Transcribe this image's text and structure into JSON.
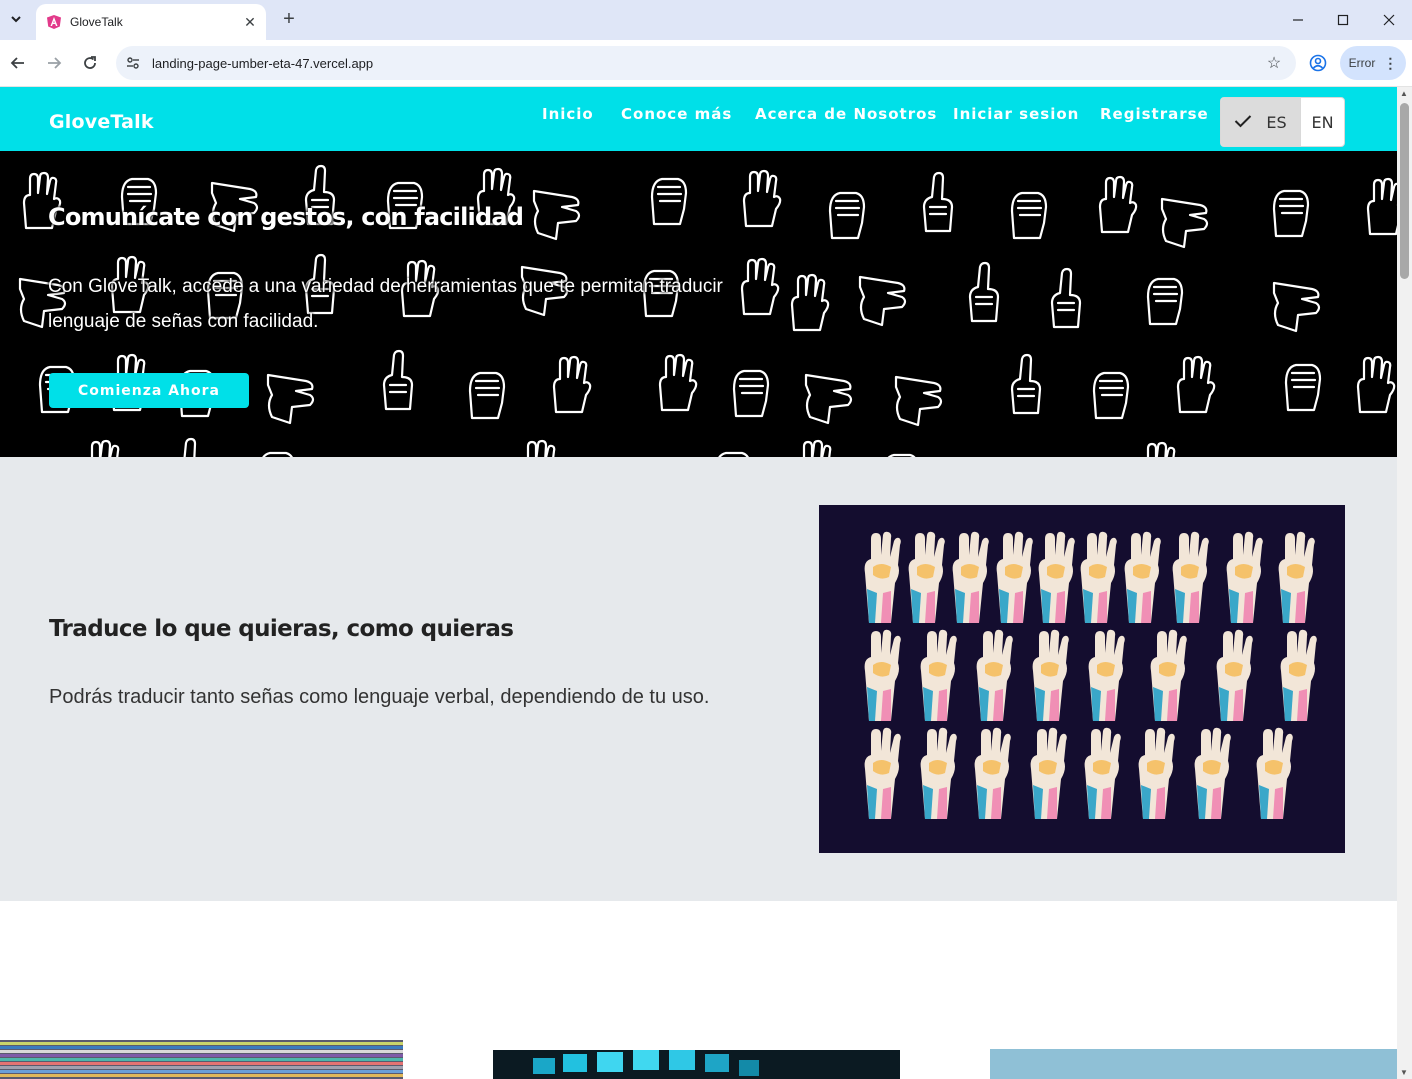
{
  "browser": {
    "tab_title": "GloveTalk",
    "url": "landing-page-umber-eta-47.vercel.app",
    "profile_status": "Error"
  },
  "navbar": {
    "brand": "GloveTalk",
    "links": [
      "Inicio",
      "Conoce más",
      "Acerca de Nosotros",
      "Iniciar sesion",
      "Registrarse"
    ],
    "lang_es": "ES",
    "lang_en": "EN",
    "selected_lang": "ES"
  },
  "hero": {
    "title": "Comunícate con gestos, con facilidad",
    "text": "Con GloveTalk, accede a una variedad de herramientas que te permitan traducir lenguaje de señas con facilidad.",
    "cta": "Comienza Ahora"
  },
  "feature": {
    "title": "Traduce lo que quieras, como quieras",
    "text": "Podrás traducir tanto señas como lenguaje verbal, dependiendo de tu uso."
  },
  "colors": {
    "accent": "#00e0e8",
    "hero_bg": "#000000",
    "feature_bg": "#e6e9ec",
    "image_bg": "#140d2f"
  },
  "icons": [
    "search-tabs-icon",
    "close-icon",
    "plus-icon",
    "minimize-icon",
    "maximize-icon",
    "window-close-icon",
    "back-icon",
    "forward-icon",
    "reload-icon",
    "site-info-icon",
    "star-icon",
    "profile-icon",
    "more-icon",
    "check-icon",
    "scroll-up-icon",
    "scroll-down-icon"
  ]
}
